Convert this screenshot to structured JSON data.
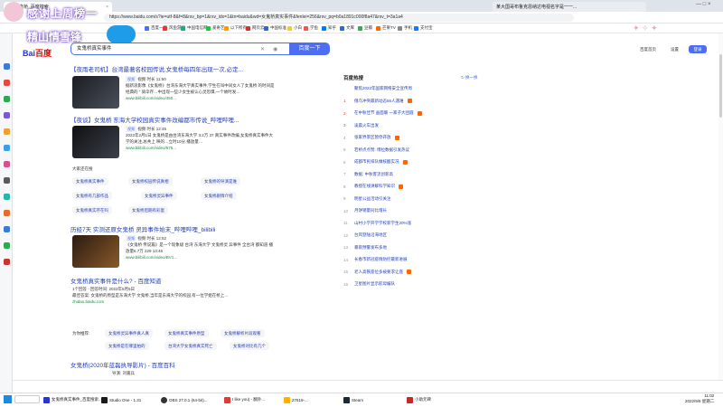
{
  "browser": {
    "tabs": [
      {
        "label": "女鬼桥_百度搜索"
      },
      {
        "label": "某大国哥布鲁克恩纳达电视名字是一一..."
      }
    ],
    "url": "https://www.baidu.com/s?ie=utf-8&f=8&rsv_bp=1&rsv_idx=1&tn=baidu&wd=女鬼桥真实事件&fenlei=256&rsv_pq=b0a1891c000f8a47&rsv_t=3a1a4",
    "bookmarks": [
      "百度一下",
      "风鱼游戏",
      "中国电信网",
      "爱奇艺",
      "以下所有",
      "网页云",
      "中国标准",
      "小白",
      "学鱼",
      "知乎",
      "文库",
      "豆瓣",
      "芒果TV",
      "手机",
      "支付宝"
    ]
  },
  "overlay": {
    "line1": "感谢上周榜一",
    "line2": "精山情雪锋"
  },
  "search": {
    "logo_bai": "Bai",
    "logo_du": "百度",
    "query": "女鬼桥真实事件",
    "button_label": "百度一下",
    "top_links": [
      "百度首页",
      "设置"
    ],
    "login_label": "登录"
  },
  "results": [
    {
      "title": "【夜雨老司机】台湾最著名校园传说,女鬼桥每四年出现一次,必定...",
      "meta": "视频  时长 11:50",
      "desc": "据新浪影像《女鬼桥》台湾东海大学真实事件,学生在叫中间女人了女鬼桥 的时间是经典的 “ 骑伞存…中出现一些少女生被认心灵恐惧,一个故时发…",
      "source": "www.bilibili.com/video/450..."
    },
    {
      "title": "【夜谈】女鬼桥 东海大学校园真实事件改编都市传说_哔哩哔哩...",
      "meta": "视频  时长 12:45",
      "desc": "2022年2月1日 女鬼桥是由台湾东海大学 3.2万 37 真实事件改编,女鬼桥真实事件大学的关注,总共上 映的…立时10分,播放量…",
      "source": "www.bilibili.com/video/675..."
    },
    {
      "title": "历经7天 实测还原女鬼桥 灵异事件始末_哔哩哔哩_bilibili",
      "meta": "视频  时长 12:52",
      "desc": "《女鬼桥 传说篇》是一个现象级 台湾 东海大学 文鬼桥灵 异事件 全台湾 都知道 播放量6.7万 229 13:46",
      "source": "www.bilibili.com/video/BV1..."
    },
    {
      "title": "女鬼桥真实事件是什么? - 百度知道",
      "meta": "1个回答 - 回答时间: 2022年5月5日",
      "desc": "最佳答案: 女鬼桥的原型是东海大学 文鬼桥,当年是东海大学的校园,有一位学姐在桥上…",
      "source": "zhidao.baidu.com"
    },
    {
      "title": "女鬼桥(2020年蓝磊执导影片) - 百度百科",
      "meta": "导演: 刘嘉兵",
      "desc": "",
      "source": "baike.baidu.com"
    }
  ],
  "people_also_search": {
    "heading": "大家还在搜",
    "items": [
      "女鬼桥真实事件",
      "女鬼桥校园传说真相",
      "女鬼桥的导演是谁",
      "女鬼桥有几部作品",
      "女鬼桥照片出现在",
      "女鬼桥拍摄地点",
      "女鬼桥灵异事件",
      "女鬼桥剧情介绍",
      "女鬼桥真实存在吗",
      "女鬼桥后期有彩蛋"
    ]
  },
  "related": {
    "heading": "为你推荐:",
    "items": [
      "女鬼桥灵异事件真人真",
      "女鬼桥真实事件原型",
      "女鬼桥解析片段观看",
      "女鬼桥是在哪里拍的",
      "台湾大学女鬼桥真实死亡",
      "女鬼桥对比有几个"
    ]
  },
  "hotlist": {
    "heading": "百度热搜",
    "refresh_label": "换一换",
    "items": [
      {
        "num": "",
        "text": "聚焦2022年国家网络安全宣传周",
        "hot": false
      },
      {
        "num": "1",
        "text": "俄乌冲突最新动态56人遇难",
        "hot": true
      },
      {
        "num": "2",
        "text": "在中秋佳节 画面暖 一家子大团圆",
        "hot": true
      },
      {
        "num": "3",
        "text": "凌晨火车出发",
        "hot": false
      },
      {
        "num": "4",
        "text": "张家界景区暂停开放",
        "hot": true
      },
      {
        "num": "5",
        "text": "若桥点点赞: 博拉数据引发热议",
        "hot": false
      },
      {
        "num": "6",
        "text": "成都市民排队做核酸实况",
        "hot": true
      },
      {
        "num": "7",
        "text": "数据: 中秋客流创新高",
        "hot": false
      },
      {
        "num": "8",
        "text": "教授在线讲解科学知识",
        "hot": true
      },
      {
        "num": "9",
        "text": "明星公益活动引关注",
        "hot": false
      },
      {
        "num": "10",
        "text": "月饼销量同比增长",
        "hot": false
      },
      {
        "num": "11",
        "text": "山村小学开学学校新学生20%涨",
        "hot": false
      },
      {
        "num": "12",
        "text": "台风登陆沿海地区",
        "hot": false
      },
      {
        "num": "13",
        "text": "暴雨预警发布多地",
        "hot": false
      },
      {
        "num": "14",
        "text": "长春市新冠疫情防控最新进展",
        "hot": false
      },
      {
        "num": "15",
        "text": "老人高铁座位多被要求让座",
        "hot": true
      },
      {
        "num": "16",
        "text": "卫星图片显示航母编队",
        "hot": false
      }
    ]
  },
  "taskbar": {
    "items": [
      "女鬼桥真实事件_百度搜索...",
      "Studio One - 1.31",
      "OBS 27.0.1 (64-bit)...",
      "I like you) - 翻外...",
      "27619-...",
      "Steam",
      "小助元碑"
    ],
    "time": "11:02",
    "date": "2022/9/6 星期二"
  },
  "colors": {
    "accent": "#4e6ef2",
    "link": "#2440b3",
    "highlight": "#f73131"
  }
}
